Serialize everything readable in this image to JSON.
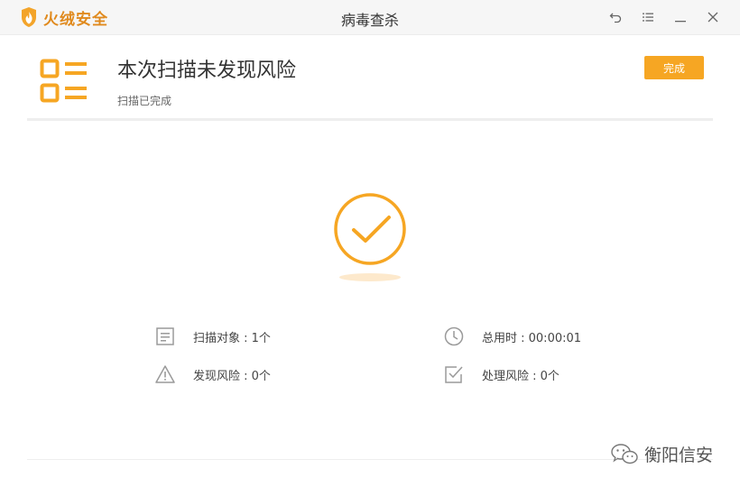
{
  "app": {
    "brand_name": "火绒安全",
    "window_title": "病毒查杀"
  },
  "window_controls": {
    "icons": [
      "back-icon",
      "menu-icon",
      "minimize-icon",
      "close-icon"
    ]
  },
  "summary": {
    "title": "本次扫描未发现风险",
    "subtitle": "扫描已完成",
    "done_label": "完成"
  },
  "stats": {
    "scan_objects": "扫描对象 : 1个",
    "total_time": "总用时 : 00:00:01",
    "risks_found": "发现风险 : 0个",
    "risks_handled": "处理风险 : 0个"
  },
  "watermark": {
    "text": "衡阳信安"
  },
  "colors": {
    "accent": "#f6a623",
    "brand": "#e08a1e",
    "icon_gray": "#9a9a9a"
  }
}
